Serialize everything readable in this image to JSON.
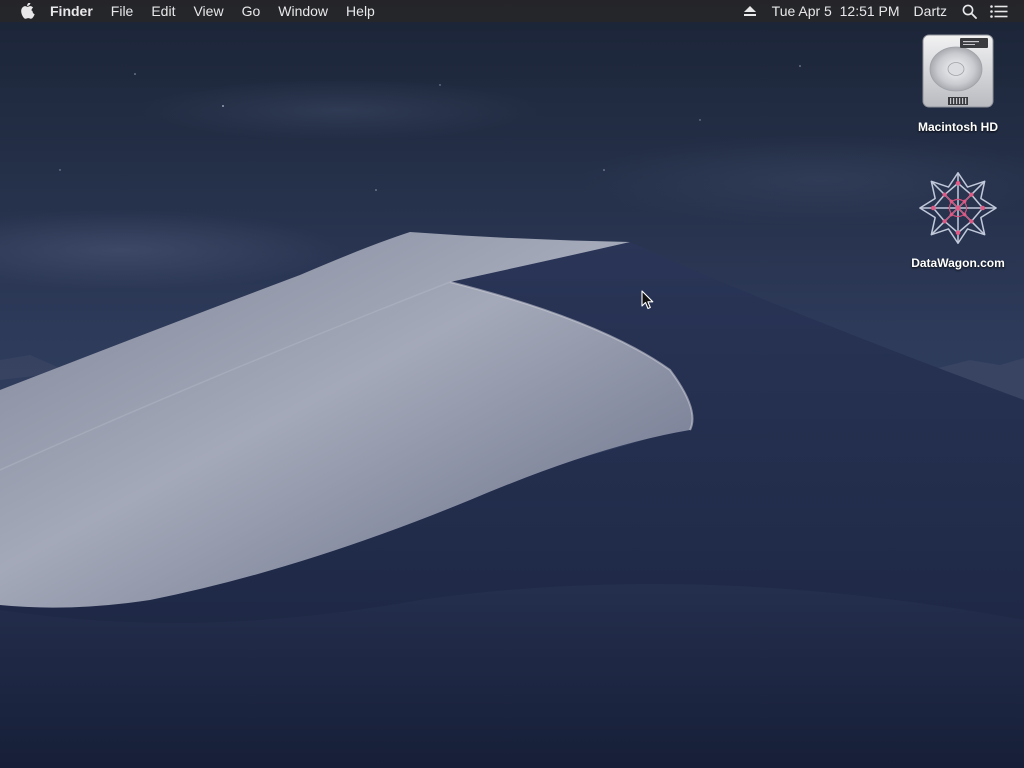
{
  "menubar": {
    "app_name": "Finder",
    "menus": [
      "File",
      "Edit",
      "View",
      "Go",
      "Window",
      "Help"
    ],
    "icons": {
      "apple": "apple-logo-icon",
      "eject": "eject-icon",
      "search": "spotlight-search-icon",
      "notifications": "notification-center-icon"
    },
    "clock": "Tue Apr 5  12:51 PM",
    "user": "Dartz"
  },
  "desktop": {
    "items": [
      {
        "label": "Macintosh HD",
        "icon": "hard-drive-icon"
      },
      {
        "label": "DataWagon.com",
        "icon": "network-star-icon"
      }
    ]
  },
  "colors": {
    "menubar_bg": "#262628",
    "sky_top": "#1b2438",
    "sky_mid": "#2d3a5a",
    "dune_light": "#a9aebd",
    "dune_dark": "#1d2845"
  }
}
